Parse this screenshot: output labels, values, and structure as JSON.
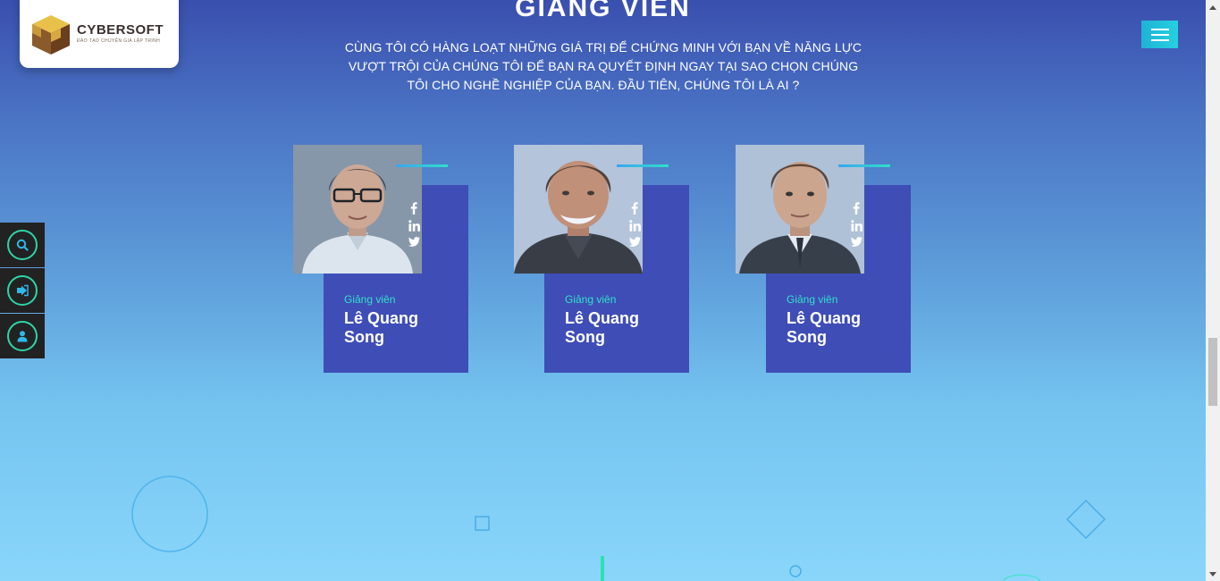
{
  "brand": {
    "name": "CYBERSOFT",
    "tagline": "ĐÀO TẠO CHUYÊN GIA LẬP TRÌNH",
    "colors": {
      "accent": "#25d0e0",
      "card": "#3f4db7",
      "role": "#33e0c8"
    }
  },
  "header": {
    "menu_icon": "hamburger-icon"
  },
  "section": {
    "title": "GIẢNG VIÊN",
    "description": "CÙNG TÔI CÓ HÀNG LOẠT NHỮNG GIÁ TRỊ ĐỂ CHỨNG MINH VỚI BẠN VỀ NĂNG LỰC VƯỢT TRỘI CỦA CHÚNG TÔI ĐỂ BẠN RA QUYẾT ĐỊNH NGAY TẠI SAO CHỌN CHÚNG TÔI CHO NGHỀ NGHIỆP CỦA BẠN. ĐẦU TIÊN, CHÚNG TÔI LÀ AI ?"
  },
  "sidebar": {
    "items": [
      {
        "icon": "search-icon"
      },
      {
        "icon": "sign-in-icon"
      },
      {
        "icon": "user-icon"
      }
    ]
  },
  "instructors": [
    {
      "role": "Giảng viên",
      "name": "Lê Quang Song",
      "social": [
        "facebook-icon",
        "linkedin-icon",
        "twitter-icon"
      ]
    },
    {
      "role": "Giảng viên",
      "name": "Lê Quang Song",
      "social": [
        "facebook-icon",
        "linkedin-icon",
        "twitter-icon"
      ]
    },
    {
      "role": "Giảng viên",
      "name": "Lê Quang Song",
      "social": [
        "facebook-icon",
        "linkedin-icon",
        "twitter-icon"
      ]
    }
  ]
}
